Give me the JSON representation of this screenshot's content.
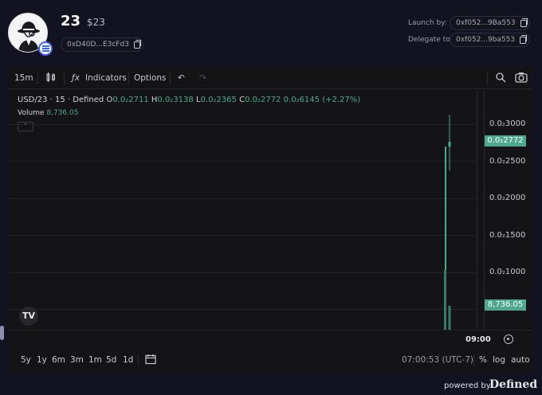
{
  "token": {
    "symbol": "23",
    "price": "$23",
    "contract": "0xD40D...E3cFd3",
    "launch_label": "Launch by:",
    "launch_address": "0xf052...9Ba553",
    "delegate_label": "Delegate to:",
    "delegate_address": "0xf052...9ba553"
  },
  "toolbar": {
    "interval": "15m",
    "indicators_label": "Indicators",
    "options_label": "Options",
    "undo_icon": "undo-icon",
    "redo_icon": "redo-icon"
  },
  "legend": {
    "symbol_line": "USD/23 · 15 · Defined",
    "open_key": "O",
    "open_value": "0.0₂2711",
    "high_key": "H",
    "high_value": "0.0₂3138",
    "low_key": "L",
    "low_value": "0.0₂2365",
    "close_key": "C",
    "close_value": "0.0₂2772",
    "change_value": "0.0₂6145 (+2.27%)",
    "volume_label": "Volume",
    "volume_value": "8,736.05"
  },
  "price_axis": {
    "ticks": [
      "0.0₂3000",
      "0.0₂2500",
      "0.0₂2000",
      "0.0₂1500",
      "0.0₂1000"
    ],
    "last_price": "0.0₂2772",
    "volume_tag": "8,736.05"
  },
  "time_axis": {
    "label": "09:00"
  },
  "bottom_bar": {
    "ranges": [
      "5y",
      "1y",
      "6m",
      "3m",
      "1m",
      "5d",
      "1d"
    ],
    "clock": "07:00:53 (UTC-7)",
    "percent_label": "%",
    "log_label": "log",
    "auto_label": "auto"
  },
  "footer": {
    "powered_by": "powered by",
    "brand": "Defined"
  },
  "colors": {
    "up": "#4fa88d",
    "panel": "#141416",
    "page": "#121220"
  }
}
